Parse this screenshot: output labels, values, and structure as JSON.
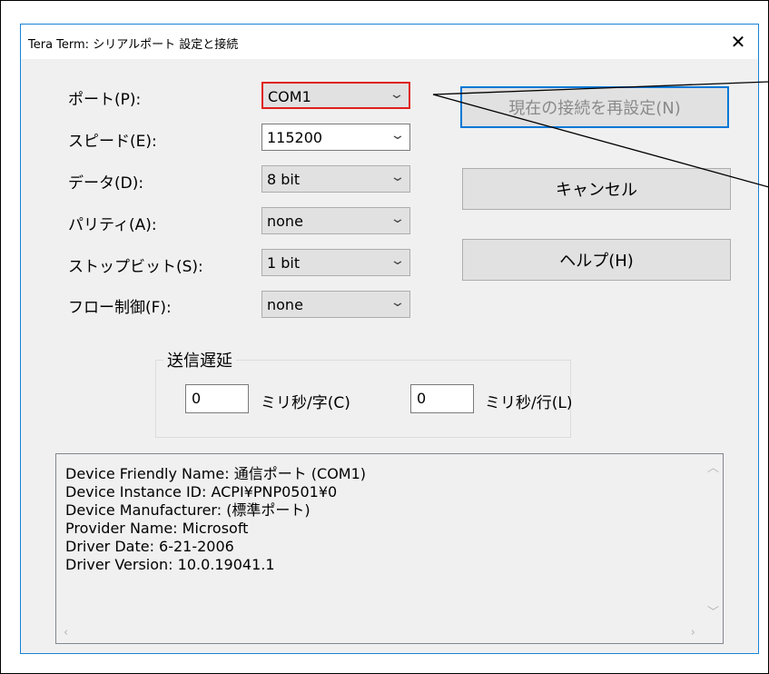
{
  "window": {
    "title": "Tera Term: シリアルポート 設定と接続",
    "close_glyph": "✕"
  },
  "settings": {
    "port_label": "ポート(P):",
    "port_value": "COM1",
    "speed_label": "スピード(E):",
    "speed_value": "115200",
    "data_label": "データ(D):",
    "data_value": "8 bit",
    "parity_label": "パリティ(A):",
    "parity_value": "none",
    "stop_label": "ストップビット(S):",
    "stop_value": "1 bit",
    "flow_label": "フロー制御(F):",
    "flow_value": "none",
    "dropdown_icon": "chevron-down-icon"
  },
  "buttons": {
    "reconnect": "現在の接続を再設定(N)",
    "cancel": "キャンセル",
    "help": "ヘルプ(H)"
  },
  "delay": {
    "title": "送信遅延",
    "char_value": "0",
    "char_unit": "ミリ秒/字(C)",
    "line_value": "0",
    "line_unit": "ミリ秒/行(L)"
  },
  "device_info": {
    "lines": [
      "Device Friendly Name: 通信ポート (COM1)",
      "Device Instance ID: ACPI¥PNP0501¥0",
      "Device Manufacturer: (標準ポート)",
      "Provider Name: Microsoft",
      "Driver Date: 6-21-2006",
      "Driver Version: 10.0.19041.1"
    ]
  },
  "colors": {
    "highlight": "#e0201c",
    "accent": "#0078d7"
  }
}
